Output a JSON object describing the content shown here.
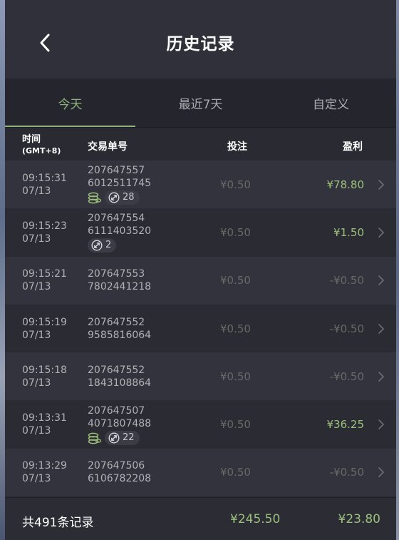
{
  "header": {
    "title": "历史记录"
  },
  "tabs": [
    {
      "label": "今天",
      "active": true
    },
    {
      "label": "最近7天",
      "active": false
    },
    {
      "label": "自定义",
      "active": false
    }
  ],
  "columns": {
    "time": "时间",
    "time_sub": "(GMT+8)",
    "order": "交易单号",
    "bet": "投注",
    "profit": "盈利"
  },
  "rows": [
    {
      "time": "09:15:31",
      "date": "07/13",
      "order_line1": "207647557",
      "order_line2": "6012511745",
      "coin": true,
      "multiplier": "28",
      "bet": "¥0.50",
      "profit": "¥78.80",
      "positive": true
    },
    {
      "time": "09:15:23",
      "date": "07/13",
      "order_line1": "207647554",
      "order_line2": "6111403520",
      "coin": false,
      "multiplier": "2",
      "bet": "¥0.50",
      "profit": "¥1.50",
      "positive": true
    },
    {
      "time": "09:15:21",
      "date": "07/13",
      "order_line1": "207647553",
      "order_line2": "7802441218",
      "coin": false,
      "multiplier": null,
      "bet": "¥0.50",
      "profit": "-¥0.50",
      "positive": false
    },
    {
      "time": "09:15:19",
      "date": "07/13",
      "order_line1": "207647552",
      "order_line2": "9585816064",
      "coin": false,
      "multiplier": null,
      "bet": "¥0.50",
      "profit": "-¥0.50",
      "positive": false
    },
    {
      "time": "09:15:18",
      "date": "07/13",
      "order_line1": "207647552",
      "order_line2": "1843108864",
      "coin": false,
      "multiplier": null,
      "bet": "¥0.50",
      "profit": "-¥0.50",
      "positive": false
    },
    {
      "time": "09:13:31",
      "date": "07/13",
      "order_line1": "207647507",
      "order_line2": "4071807488",
      "coin": true,
      "multiplier": "22",
      "bet": "¥0.50",
      "profit": "¥36.25",
      "positive": true
    },
    {
      "time": "09:13:29",
      "date": "07/13",
      "order_line1": "207647506",
      "order_line2": "6106782208",
      "coin": false,
      "multiplier": null,
      "bet": "¥0.50",
      "profit": "-¥0.50",
      "positive": false
    }
  ],
  "footer": {
    "total_label": "共491条记录",
    "total_bet": "¥245.50",
    "total_profit": "¥23.80"
  },
  "colors": {
    "accent": "#8eb279",
    "profit_positive": "#9cc07a",
    "profit_negative": "#656a66",
    "background": "#2a2a33"
  },
  "icons": {
    "back": "chevron-left-icon",
    "row_chevron": "chevron-right-icon",
    "coin": "coin-stack-icon",
    "multiplier": "multiplier-arrows-icon"
  }
}
